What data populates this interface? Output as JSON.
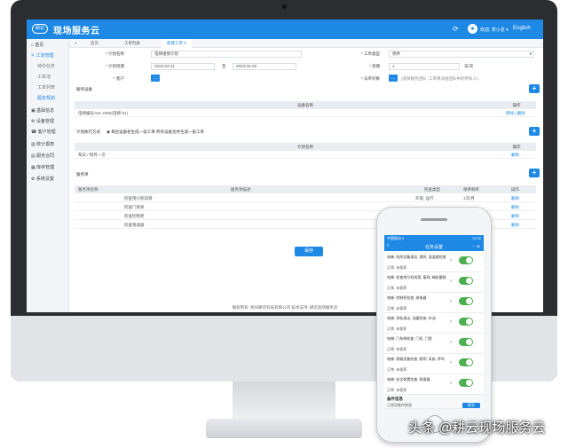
{
  "header": {
    "logo": "耕云",
    "brand": "现场服务云",
    "refresh_icon": "refresh-icon",
    "user": "欢迎, 李小龙 ▾",
    "lang": "English"
  },
  "sidebar": {
    "items": [
      {
        "label": "⌂ 首页"
      },
      {
        "label": "✎ 工单管理"
      },
      {
        "label": "待办任务"
      },
      {
        "label": "工单池"
      },
      {
        "label": "工单列表"
      },
      {
        "label": "服务规划"
      },
      {
        "label": "▣ 基础信息"
      },
      {
        "label": "⚙ 设备管理"
      },
      {
        "label": "☎ 客户管理"
      },
      {
        "label": "▥ 统计报表"
      },
      {
        "label": "▤ 服务合同"
      },
      {
        "label": "▦ 库存管理"
      },
      {
        "label": "⚙ 系统设置"
      }
    ]
  },
  "tabs": [
    {
      "label": "首页"
    },
    {
      "label": "工单列表"
    },
    {
      "label": "新建工单"
    }
  ],
  "tab_close": "×",
  "form": {
    "plan_name_label": "* 计划名称",
    "plan_name_value": "电梯维保计划",
    "type_label": "* 工单类型",
    "type_value": "保养",
    "date_label": "* 计划周期",
    "date_start": "2023-04-21",
    "date_to": "至",
    "date_end": "2023-04-28",
    "period_label": "* 周期",
    "period_value": "1",
    "period_unit": "天/次",
    "customer_label": "* 客户",
    "customer_btn": "…",
    "team_label": "* 派单对象",
    "team_btn": "…",
    "team_hint": "(选择服务团队, 工单将派给团队中的所有人)"
  },
  "device_section": {
    "title": "服务设备",
    "col_name": "设备名称",
    "col_op": "操作",
    "rows": [
      {
        "name": "电梯编号A01-2305(电梯-01)",
        "op": "移除 | 删除"
      }
    ]
  },
  "mode_section": {
    "title": "计划执行方式",
    "option1": "每台设备各生成一张工单",
    "option2": "所有设备合并生成一张工单",
    "col_name": "计划名称",
    "col_op": "操作",
    "rows": [
      {
        "name": "每日 / 每月一次",
        "op": "删除"
      }
    ]
  },
  "item_section": {
    "title": "服务项",
    "cols": [
      "服务项名称",
      "服务项描述",
      "检查类型",
      "保养频率",
      "操作"
    ],
    "rows": [
      {
        "desc": "检查曳引机润滑",
        "type": "外观, 运行",
        "freq": "1次/月",
        "op": "删除"
      },
      {
        "desc": "检查门系统",
        "type": "",
        "freq": "",
        "op": "删除"
      },
      {
        "desc": "检查控制柜",
        "type": "",
        "freq": "",
        "op": "删除"
      },
      {
        "desc": "检查限速器",
        "type": "",
        "freq": "",
        "op": "删除"
      }
    ]
  },
  "save_btn": "保存",
  "footer": "版权所有: 杭州耕云科技有限公司   技术支持: 耕云现场服务云",
  "phone": {
    "status_left": "中国移动 ▾",
    "status_right": "12:30",
    "nav_title": "任务设置",
    "nav_right": "··· ◎",
    "items": [
      {
        "text": "电梯: 机房设备清洁, 通风, 温湿度检查",
        "status": "正常: 未保养"
      },
      {
        "text": "电梯: 检查曳引机润滑, 接线, 绳轮磨损",
        "status": "正常: 未保养"
      },
      {
        "text": "电梯: 控制柜检查, 继电器",
        "status": "正常: 未保养"
      },
      {
        "text": "电梯: 导轨清洁, 油量检查, 补油",
        "status": "正常: 未保养"
      },
      {
        "text": "电梯: 门系统检查, 门机, 门锁",
        "status": "正常: 未保养"
      },
      {
        "text": "电梯: 轿厢设备检查, 照明, 风扇, 呼叫",
        "status": "正常: 未保养"
      },
      {
        "text": "电梯: 安全装置检查, 限速器",
        "status": "正常: 未保养"
      }
    ],
    "remark_title": "备件信息",
    "remark_text": "已使用备件数量",
    "submit": "提交"
  },
  "watermark": "头条 @耕云现场服务云",
  "colors": {
    "accent": "#1e88e5",
    "toggle": "#4caf50"
  }
}
